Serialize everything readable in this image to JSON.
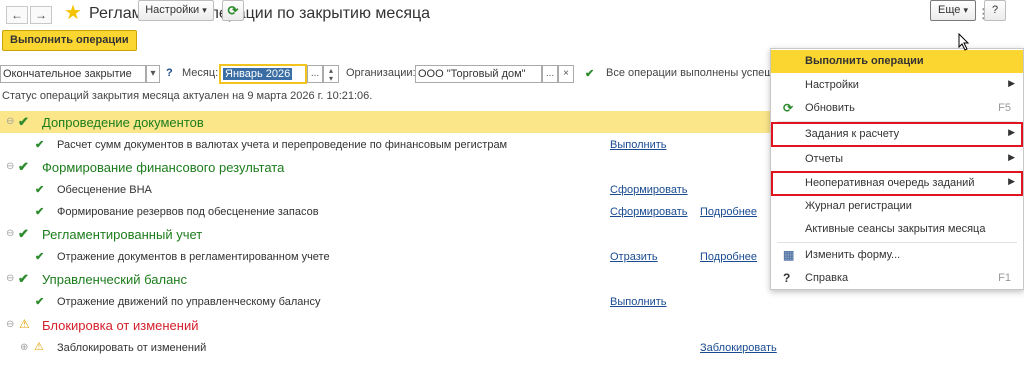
{
  "window": {
    "title": "Регламентные операции по закрытию месяца",
    "back_icon": "←",
    "forward_icon": "→",
    "link_icon": "🔗",
    "more_icon": "⋮",
    "close_icon": "×"
  },
  "toolbar": {
    "run_label": "Выполнить операции",
    "settings_label": "Настройки",
    "settings_arrow": "▾",
    "refresh_icon": "⟳",
    "more_label": "Еще",
    "more_arrow": "▾",
    "help_label": "?"
  },
  "filters": {
    "closing_type_value": "Окончательное закрытие",
    "closing_type_arrow": "▾",
    "help_mark": "?",
    "month_label": "Месяц:",
    "month_value": "Январь 2026",
    "ellipsis": "...",
    "spin_up": "▴",
    "spin_down": "▾",
    "org_label": "Организации:",
    "org_value": "ООО \"Торговый дом\"",
    "clear_icon": "×",
    "done_icon": "✔",
    "done_text": "Все операции выполнены успешно"
  },
  "status_line": "Статус операций закрытия месяца актуален на 9 марта 2026 г. 10:21:06.",
  "list": {
    "expand_icon": "⊖",
    "collapsed_icon": "⊕",
    "check_icon": "✔",
    "warn_icon": "⚠",
    "groups": [
      {
        "title": "Допроведение документов",
        "items": [
          {
            "text": "Расчет сумм документов в валютах учета и перепроведение по финансовым регистрам",
            "action": "Выполнить",
            "details": ""
          }
        ]
      },
      {
        "title": "Формирование финансового результата",
        "items": [
          {
            "text": "Обесценение ВНА",
            "action": "Сформировать",
            "details": ""
          },
          {
            "text": "Формирование резервов под обесценение запасов",
            "action": "Сформировать",
            "details": "Подробнее"
          }
        ]
      },
      {
        "title": "Регламентированный учет",
        "items": [
          {
            "text": "Отражение документов в регламентированном учете",
            "action": "Отразить",
            "details": "Подробнее"
          }
        ]
      },
      {
        "title": "Управленческий баланс",
        "items": [
          {
            "text": "Отражение движений по управленческому балансу",
            "action": "Выполнить",
            "details": ""
          }
        ]
      },
      {
        "title": "Блокировка от изменений",
        "items": [
          {
            "text": "Заблокировать от изменений",
            "action": "Заблокировать",
            "details": ""
          }
        ]
      }
    ]
  },
  "menu": {
    "submenu_arrow": "▶",
    "refresh_icon": "⟳",
    "form_icon": "▦",
    "help_icon": "?",
    "items": [
      {
        "label": "Выполнить операции",
        "shortcut": ""
      },
      {
        "label": "Настройки",
        "shortcut": ""
      },
      {
        "label": "Обновить",
        "shortcut": "F5"
      },
      {
        "label": "Задания к расчету",
        "shortcut": ""
      },
      {
        "label": "Отчеты",
        "shortcut": ""
      },
      {
        "label": "Неоперативная очередь заданий",
        "shortcut": ""
      },
      {
        "label": "Журнал регистрации",
        "shortcut": ""
      },
      {
        "label": "Активные сеансы закрытия месяца",
        "shortcut": ""
      },
      {
        "label": "Изменить форму...",
        "shortcut": ""
      },
      {
        "label": "Справка",
        "shortcut": "F1"
      }
    ]
  },
  "colors": {
    "accent_yellow": "#fbd631",
    "highlight_row": "#fbe68a",
    "success_green": "#2e8b2e",
    "group_green": "#1c7d1c",
    "error_red": "#d4202b",
    "link_blue": "#1a4b91",
    "menu_box_red": "#e0141e"
  }
}
